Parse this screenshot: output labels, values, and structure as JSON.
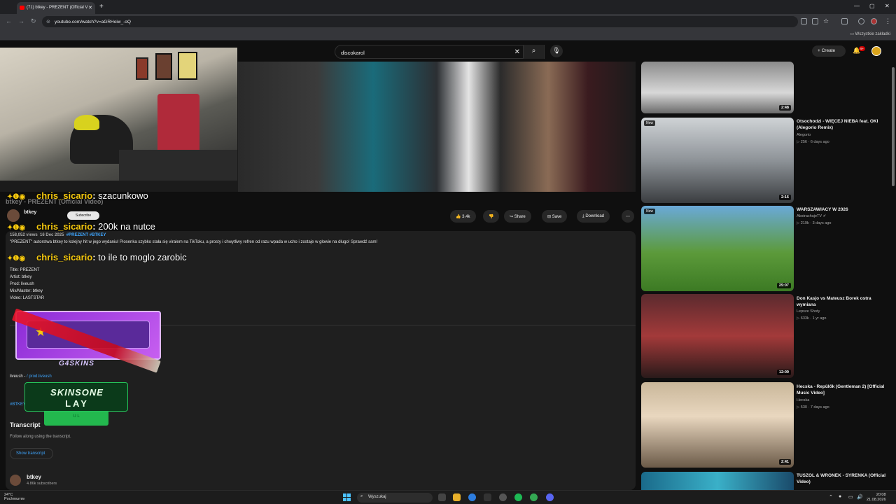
{
  "browser": {
    "tab_title": "(71) btkey - PREZENT (Official V",
    "url": "youtube.com/watch?v=aGRHoiw_-oQ",
    "bookmarks_label": "Wszystkie zakładki"
  },
  "header": {
    "search_value": "discokarol",
    "create_label": "Create",
    "notif_count": "9+"
  },
  "chat": [
    {
      "user": "chris_sicario",
      "message": "szacunkowo"
    },
    {
      "user": "chris_sicario",
      "message": "200k na nutce"
    },
    {
      "user": "chris_sicario",
      "message": "to ile to moglo zarobic"
    }
  ],
  "video": {
    "title": "btkey - PREZENT (Official Video)",
    "channel": "btkey",
    "subscribers": "4.86k subscribers",
    "subscribe_label": "Subscribe",
    "likes": "3.4k",
    "share_label": "Share",
    "save_label": "Save",
    "download_label": "Download",
    "views": "158,052 views",
    "date": "16 Dec 2025",
    "tags": "#PREZENT #BTKEY",
    "description": "\"PREZENT\" autorstwa btkey to kolejny hit w jego wydaniu! Piosenka szybko stała się viralem na TikToku, a prosty i chwytliwy refren od razu wpada w ucho i zostaje w głowie na długo! Sprawdź sam!",
    "credits": [
      "Title: PREZENT",
      "Artist: btkey",
      "Prod: liveush",
      "Mix/Master: btkey",
      "Video: LASTSTAR"
    ],
    "producer_line": "liveush - ",
    "producer_handle": "/ prod.liveush",
    "hashtags": "#BTKEY #PREZENT",
    "transcript_heading": "Transcript",
    "transcript_sub": "Follow along using the transcript.",
    "show_transcript": "Show transcript"
  },
  "overlays": {
    "g4skins": "G4SKINS",
    "skinsone_top": "SKINSONE",
    "skinsone_bottom": "LAY",
    "skinsone_tab": "U L"
  },
  "related": [
    {
      "title": "",
      "channel": "",
      "meta": "",
      "duration": "2:48",
      "new": false
    },
    {
      "title": "Otsochodzi - WIĘCEJ NIEBA feat. OKI (Alegorio Remix)",
      "channel": "Alegorio",
      "meta": "▷ 256 · 6 days ago",
      "duration": "2:16",
      "new": true
    },
    {
      "title": "WARSZAWIACY W 2026",
      "channel": "AbstrachujeTV",
      "meta": "▷ 219k · 3 days ago",
      "duration": "25:07",
      "new": true
    },
    {
      "title": "Don Kasjo vs Mateusz Borek ostra wymiana",
      "channel": "Lepsze Shoty",
      "meta": "▷ 633k · 1 yr ago",
      "duration": "12:09",
      "new": false
    },
    {
      "title": "Hecska - Repülők (Gentleman 2) [Official Music Video]",
      "channel": "Hecska",
      "meta": "▷ 530 · 7 days ago",
      "duration": "2:41",
      "new": false
    },
    {
      "title": "TUSZOL & WRONEK - SYRENKA (Official Video)",
      "channel": "",
      "meta": "",
      "duration": "",
      "new": false
    }
  ],
  "taskbar": {
    "temp": "24°C",
    "weather": "Pochmurnie",
    "search": "Wyszukaj",
    "time": "20:08",
    "date": "21.08.2026"
  },
  "colors": {
    "accent": "#3ea6ff",
    "chat_user": "#f6c90e",
    "yt_red": "#ff0000"
  }
}
